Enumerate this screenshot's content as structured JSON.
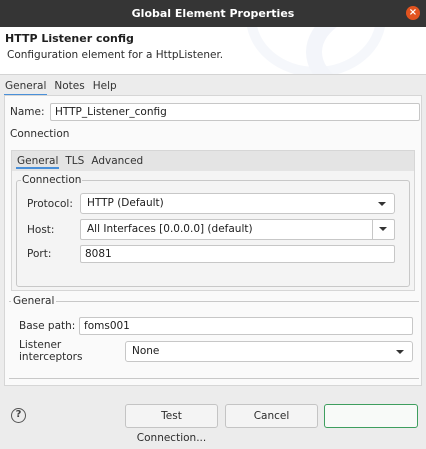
{
  "window": {
    "title": "Global Element Properties"
  },
  "header": {
    "title": "HTTP Listener config",
    "description": "Configuration element for a HttpListener."
  },
  "tabs": [
    {
      "label": "General",
      "active": true
    },
    {
      "label": "Notes",
      "active": false
    },
    {
      "label": "Help",
      "active": false
    }
  ],
  "name": {
    "label": "Name:",
    "value": "HTTP_Listener_config"
  },
  "connection_heading": "Connection",
  "connection_tabs": [
    {
      "label": "General",
      "active": true
    },
    {
      "label": "TLS",
      "active": false
    },
    {
      "label": "Advanced",
      "active": false
    }
  ],
  "connection_group": {
    "legend": "Connection",
    "protocol": {
      "label": "Protocol:",
      "value": "HTTP (Default)"
    },
    "host": {
      "label": "Host:",
      "value": "All Interfaces [0.0.0.0] (default)"
    },
    "port": {
      "label": "Port:",
      "value": "8081"
    }
  },
  "general_group": {
    "legend": "General",
    "base_path": {
      "label": "Base path:",
      "value": "foms001"
    },
    "listener_interceptors": {
      "label": "Listener interceptors",
      "value": "None"
    }
  },
  "footer": {
    "help_icon": "question-circle-icon",
    "test_connection_label": "Test Connection...",
    "cancel_label": "Cancel",
    "ok_label": ""
  },
  "colors": {
    "titlebar": "#353535",
    "close_button": "#e2531f",
    "active_tab_underline": "#4a90d9",
    "primary_button_border": "#3e9e5e"
  }
}
